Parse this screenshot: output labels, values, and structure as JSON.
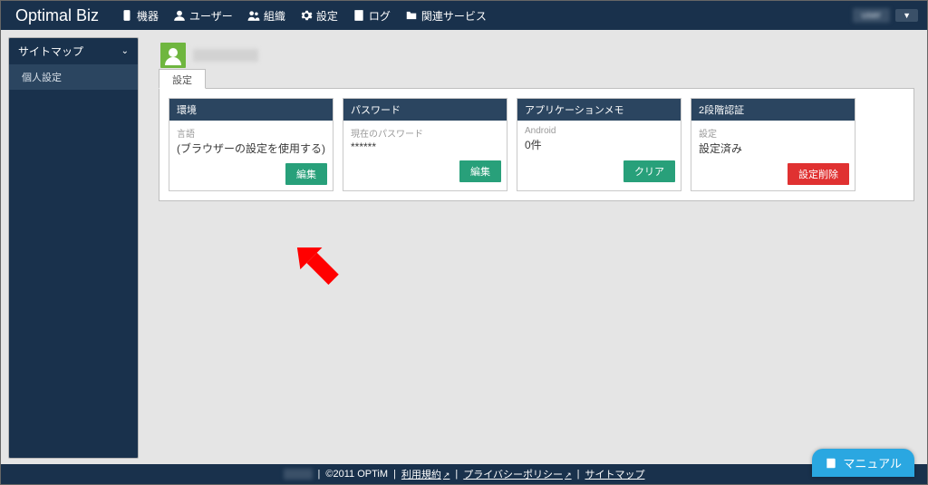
{
  "brand": "Optimal Biz",
  "nav": {
    "items": [
      {
        "label": "機器",
        "icon": "device"
      },
      {
        "label": "ユーザー",
        "icon": "user"
      },
      {
        "label": "組織",
        "icon": "org"
      },
      {
        "label": "設定",
        "icon": "gear"
      },
      {
        "label": "ログ",
        "icon": "log"
      },
      {
        "label": "関連サービス",
        "icon": "folder"
      }
    ]
  },
  "sidebar": {
    "title": "サイトマップ",
    "items": [
      {
        "label": "個人設定"
      }
    ]
  },
  "tab": {
    "label": "設定"
  },
  "cards": {
    "env": {
      "header": "環境",
      "field_label": "言語",
      "field_value": "(ブラウザーの設定を使用する)",
      "button": "編集"
    },
    "password": {
      "header": "パスワード",
      "field_label": "現在のパスワード",
      "field_value": "******",
      "button": "編集"
    },
    "appmemo": {
      "header": "アプリケーションメモ",
      "field_label": "Android",
      "field_value": "0件",
      "button": "クリア"
    },
    "twofa": {
      "header": "2段階認証",
      "field_label": "設定",
      "field_value": "設定済み",
      "button": "設定削除"
    }
  },
  "footer": {
    "copyright": "©2011 OPTiM",
    "links": {
      "terms": "利用規約",
      "privacy": "プライバシーポリシー",
      "sitemap": "サイトマップ"
    }
  },
  "manual_button": "マニュアル"
}
